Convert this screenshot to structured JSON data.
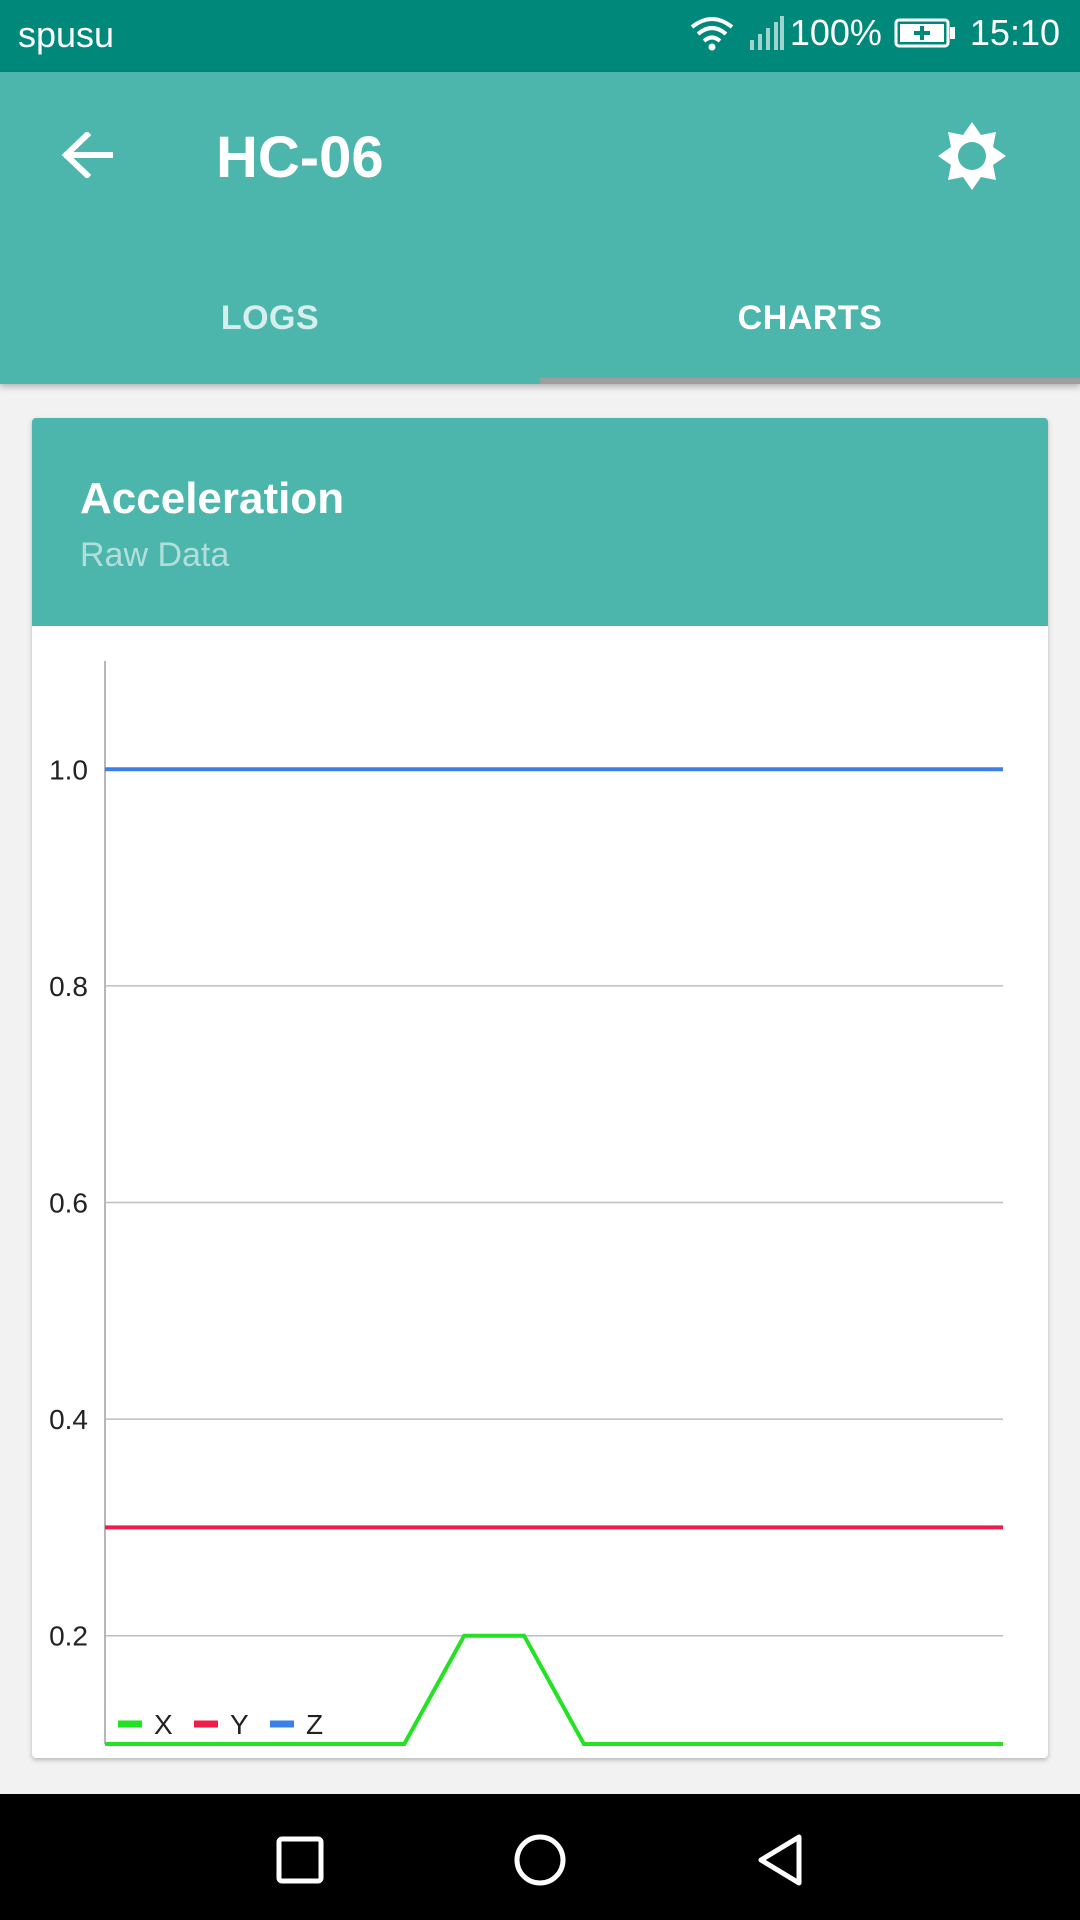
{
  "status_bar": {
    "carrier": "spusu",
    "battery": "100%",
    "time": "15:10"
  },
  "app_bar": {
    "title": "HC-06",
    "back_icon": "arrow-back-icon",
    "settings_icon": "brightness-icon"
  },
  "tabs": [
    {
      "label": "LOGS",
      "selected": false
    },
    {
      "label": "CHARTS",
      "selected": true
    }
  ],
  "card": {
    "title": "Acceleration",
    "subtitle": "Raw Data"
  },
  "chart_data": {
    "type": "line",
    "x": [
      0,
      1,
      2,
      3,
      4,
      5,
      6,
      7,
      8,
      9,
      10,
      11,
      12,
      13,
      14,
      15
    ],
    "series": [
      {
        "name": "X",
        "color": "#22e222",
        "values": [
          0.1,
          0.1,
          0.1,
          0.1,
          0.1,
          0.1,
          0.2,
          0.2,
          0.1,
          0.1,
          0.1,
          0.1,
          0.1,
          0.1,
          0.1,
          0.1
        ]
      },
      {
        "name": "Y",
        "color": "#ee1e48",
        "values": [
          0.3,
          0.3,
          0.3,
          0.3,
          0.3,
          0.3,
          0.3,
          0.3,
          0.3,
          0.3,
          0.3,
          0.3,
          0.3,
          0.3,
          0.3,
          0.3
        ]
      },
      {
        "name": "Z",
        "color": "#3b80e6",
        "values": [
          1.0,
          1.0,
          1.0,
          1.0,
          1.0,
          1.0,
          1.0,
          1.0,
          1.0,
          1.0,
          1.0,
          1.0,
          1.0,
          1.0,
          1.0,
          1.0
        ]
      }
    ],
    "yticks": [
      "0.2",
      "0.4",
      "0.6",
      "0.8",
      "1.0"
    ],
    "ylim": [
      0.1,
      1.1
    ],
    "xlabel": "",
    "ylabel": "",
    "grid": true,
    "legend": "bottom-left"
  },
  "nav": {
    "recents_icon": "square-icon",
    "home_icon": "circle-icon",
    "back_icon": "triangle-back-icon"
  }
}
